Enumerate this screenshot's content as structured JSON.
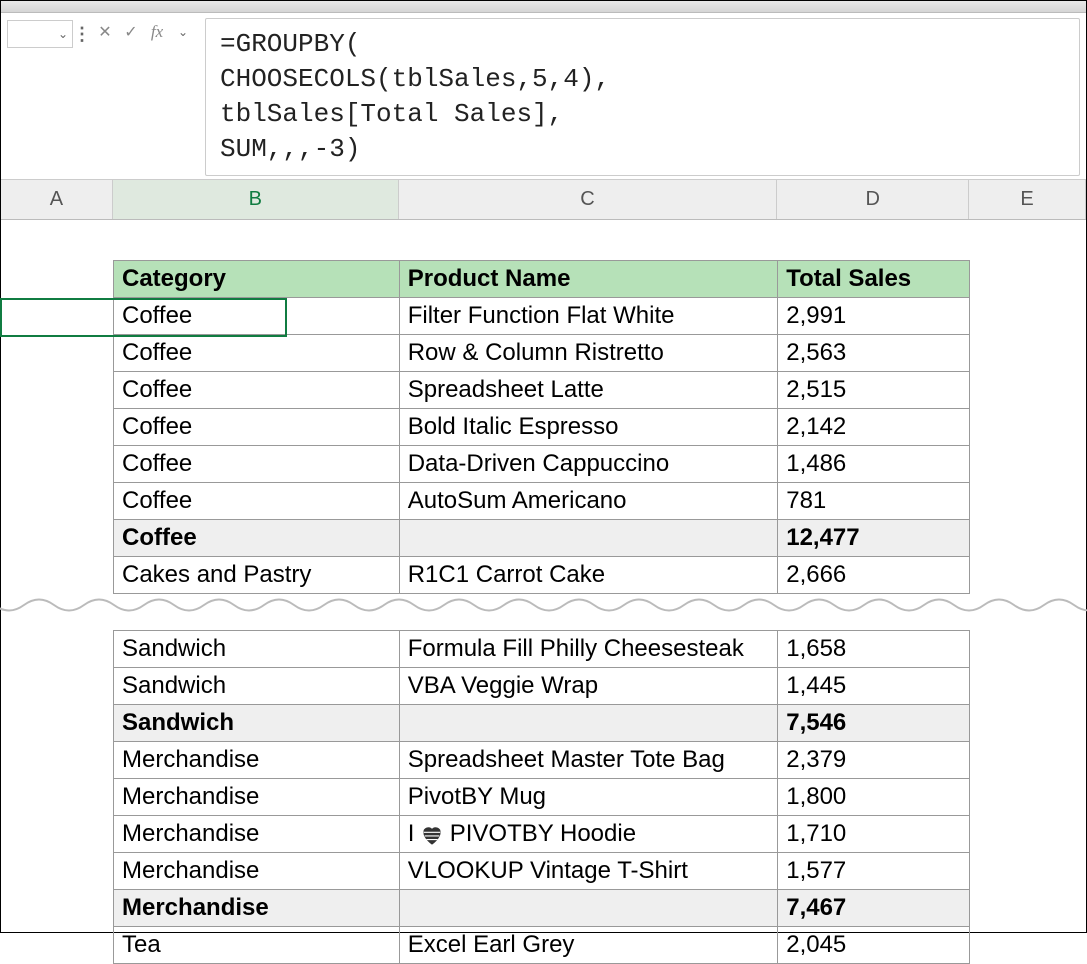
{
  "formula_bar": {
    "cancel_icon": "✕",
    "enter_icon": "✓",
    "fx_label": "fx",
    "dropdown_icon": "⌄",
    "formula": "=GROUPBY(\nCHOOSECOLS(tblSales,5,4),\ntblSales[Total Sales],\nSUM,,,-3)"
  },
  "columns": [
    {
      "letter": "A",
      "class": "col-A",
      "selected": false
    },
    {
      "letter": "B",
      "class": "col-B",
      "selected": true
    },
    {
      "letter": "C",
      "class": "col-C",
      "selected": false
    },
    {
      "letter": "D",
      "class": "col-D",
      "selected": false
    },
    {
      "letter": "E",
      "class": "col-E",
      "selected": false
    }
  ],
  "table": {
    "headers": {
      "category": "Category",
      "product": "Product Name",
      "sales": "Total Sales"
    },
    "rows": [
      {
        "type": "data",
        "category": "Coffee",
        "product": "Filter Function Flat White",
        "sales": "2,991"
      },
      {
        "type": "data",
        "category": "Coffee",
        "product": "Row & Column Ristretto",
        "sales": "2,563"
      },
      {
        "type": "data",
        "category": "Coffee",
        "product": "Spreadsheet Latte",
        "sales": "2,515"
      },
      {
        "type": "data",
        "category": "Coffee",
        "product": "Bold Italic Espresso",
        "sales": "2,142"
      },
      {
        "type": "data",
        "category": "Coffee",
        "product": "Data-Driven Cappuccino",
        "sales": "1,486"
      },
      {
        "type": "data",
        "category": "Coffee",
        "product": "AutoSum Americano",
        "sales": "781"
      },
      {
        "type": "subtotal",
        "category": "Coffee",
        "product": "",
        "sales": "12,477"
      },
      {
        "type": "data",
        "category": "Cakes and Pastry",
        "product": "R1C1 Carrot Cake",
        "sales": "2,666"
      },
      {
        "type": "tear"
      },
      {
        "type": "data",
        "category": "Sandwich",
        "product": "Formula Fill Philly Cheesesteak",
        "sales": "1,658"
      },
      {
        "type": "data",
        "category": "Sandwich",
        "product": "VBA Veggie Wrap",
        "sales": "1,445"
      },
      {
        "type": "subtotal",
        "category": "Sandwich",
        "product": "",
        "sales": "7,546"
      },
      {
        "type": "data",
        "category": "Merchandise",
        "product": "Spreadsheet Master Tote Bag",
        "sales": "2,379"
      },
      {
        "type": "data",
        "category": "Merchandise",
        "product": "PivotBY Mug",
        "sales": "1,800"
      },
      {
        "type": "data-heart",
        "category": "Merchandise",
        "product_prefix": "I ",
        "product_suffix": " PIVOTBY Hoodie",
        "sales": "1,710"
      },
      {
        "type": "data",
        "category": "Merchandise",
        "product": "VLOOKUP Vintage T-Shirt",
        "sales": "1,577"
      },
      {
        "type": "subtotal",
        "category": "Merchandise",
        "product": "",
        "sales": "7,467"
      },
      {
        "type": "data",
        "category": "Tea",
        "product": "Excel Earl Grey",
        "sales": "2,045"
      }
    ]
  },
  "chart_data": {
    "type": "table",
    "title": "Sales grouped by Category and Product",
    "columns": [
      "Category",
      "Product Name",
      "Total Sales"
    ],
    "groups": [
      {
        "category": "Coffee",
        "subtotal": 12477,
        "items": [
          {
            "product": "Filter Function Flat White",
            "sales": 2991
          },
          {
            "product": "Row & Column Ristretto",
            "sales": 2563
          },
          {
            "product": "Spreadsheet Latte",
            "sales": 2515
          },
          {
            "product": "Bold Italic Espresso",
            "sales": 2142
          },
          {
            "product": "Data-Driven Cappuccino",
            "sales": 1486
          },
          {
            "product": "AutoSum Americano",
            "sales": 781
          }
        ]
      },
      {
        "category": "Cakes and Pastry",
        "items": [
          {
            "product": "R1C1 Carrot Cake",
            "sales": 2666
          }
        ]
      },
      {
        "category": "Sandwich",
        "subtotal": 7546,
        "items": [
          {
            "product": "Formula Fill Philly Cheesesteak",
            "sales": 1658
          },
          {
            "product": "VBA Veggie Wrap",
            "sales": 1445
          }
        ]
      },
      {
        "category": "Merchandise",
        "subtotal": 7467,
        "items": [
          {
            "product": "Spreadsheet Master Tote Bag",
            "sales": 2379
          },
          {
            "product": "PivotBY Mug",
            "sales": 1800
          },
          {
            "product": "I ♥ PIVOTBY Hoodie",
            "sales": 1710
          },
          {
            "product": "VLOOKUP Vintage T-Shirt",
            "sales": 1577
          }
        ]
      },
      {
        "category": "Tea",
        "items": [
          {
            "product": "Excel Earl Grey",
            "sales": 2045
          }
        ]
      }
    ]
  }
}
